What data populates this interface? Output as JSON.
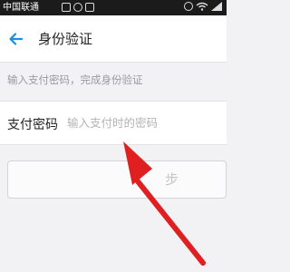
{
  "statusbar": {
    "carrier": "中国联通"
  },
  "header": {
    "title": "身份验证"
  },
  "hint": "输入支付密码，完成身份验证",
  "form": {
    "label": "支付密码",
    "placeholder": "输入支付时的密码",
    "value": ""
  },
  "next_button": {
    "label": "步"
  },
  "colors": {
    "accent": "#1a8fe0",
    "annotation_arrow": "#e02020"
  }
}
